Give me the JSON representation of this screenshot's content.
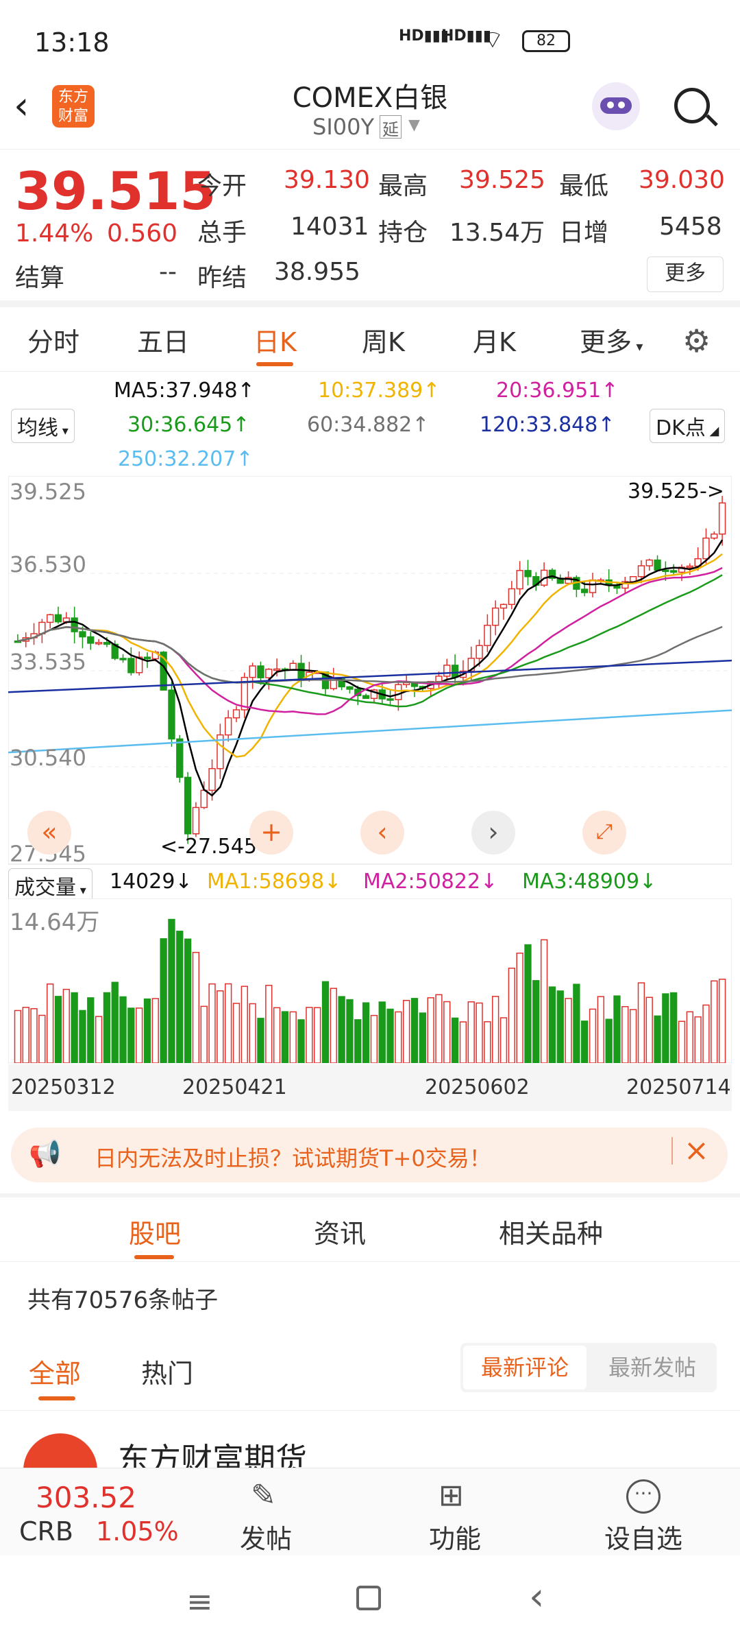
{
  "status": {
    "time": "13:18",
    "battery": "82"
  },
  "header": {
    "title": "COMEX白银",
    "code": "SI00Y",
    "delay_tag": "延",
    "logo_line1": "东方",
    "logo_line2": "财富"
  },
  "quote": {
    "price": "39.515",
    "pct": "1.44%",
    "change": "0.560",
    "open_label": "今开",
    "open": "39.130",
    "high_label": "最高",
    "high": "39.525",
    "low_label": "最低",
    "low": "39.030",
    "vol_label": "总手",
    "vol": "14031",
    "oi_label": "持仓",
    "oi": "13.54万",
    "inc_label": "日增",
    "inc": "5458",
    "settle_label": "结算",
    "settle": "--",
    "prev_label": "昨结",
    "prev": "38.955",
    "more": "更多"
  },
  "tabs": [
    {
      "label": "分时"
    },
    {
      "label": "五日"
    },
    {
      "label": "日K"
    },
    {
      "label": "周K"
    },
    {
      "label": "月K"
    },
    {
      "label": "更多"
    }
  ],
  "ma": {
    "selector": "均线",
    "dk": "DK点",
    "ma5": "MA5:37.948",
    "ma10": "10:37.389",
    "ma20": "20:36.951",
    "ma30": "30:36.645",
    "ma60": "60:34.882",
    "ma120": "120:33.848",
    "ma250": "250:32.207"
  },
  "chart_data": {
    "type": "candlestick",
    "y_ticks": [
      "39.525",
      "36.530",
      "33.535",
      "30.540",
      "27.545"
    ],
    "max_label": "39.525->",
    "min_label": "<-27.545",
    "dates": [
      "20250312",
      "20250421",
      "20250602",
      "20250714"
    ],
    "colors": {
      "up": "#e0312d",
      "down": "#1a9a1a",
      "ma5": "#000000",
      "ma10": "#f0b400",
      "ma20": "#d020a0",
      "ma30": "#1a9a1a",
      "ma60": "#707070",
      "ma120": "#1a2fa0",
      "ma250": "#5bbcf0"
    }
  },
  "volume": {
    "selector": "成交量",
    "value": "14029",
    "ma1": "MA1:58698",
    "ma2": "MA2:50822",
    "ma3": "MA3:48909",
    "max_label": "14.64万"
  },
  "banner": {
    "text": "日内无法及时止损？试试期货T+0交易！"
  },
  "subtabs": [
    {
      "label": "股吧"
    },
    {
      "label": "资讯"
    },
    {
      "label": "相关品种"
    }
  ],
  "forum": {
    "count": "共有70576条帖子",
    "all": "全部",
    "hot": "热门",
    "latest_comment": "最新评论",
    "latest_post": "最新发帖",
    "post_author": "东方财富期货"
  },
  "bottom": {
    "crb_value": "303.52",
    "crb_label": "CRB",
    "crb_pct": "1.05%",
    "post": "发帖",
    "func": "功能",
    "watch": "设自选"
  }
}
